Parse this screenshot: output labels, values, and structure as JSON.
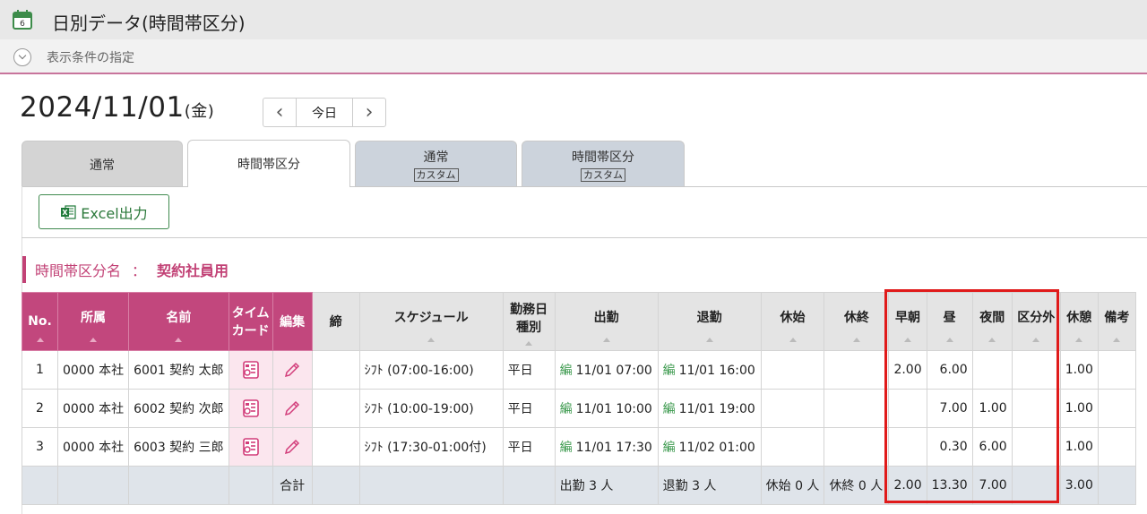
{
  "window": {
    "title": "日別データ(時間帯区分)"
  },
  "conditions": {
    "label": "表示条件の指定"
  },
  "date": {
    "value": "2024/11/01",
    "weekday": "(金)"
  },
  "nav": {
    "prev": "‹",
    "today": "今日",
    "next": "›"
  },
  "tabs": [
    {
      "label": "通常",
      "sub": ""
    },
    {
      "label": "時間帯区分",
      "sub": ""
    },
    {
      "label": "通常",
      "sub": "カスタム"
    },
    {
      "label": "時間帯区分",
      "sub": "カスタム"
    }
  ],
  "toolbar": {
    "excel_label": "Excel出力"
  },
  "section": {
    "label": "時間帯区分名",
    "separator": "：",
    "name": "契約社員用"
  },
  "table": {
    "headers": {
      "no": "No.",
      "dept": "所属",
      "name": "名前",
      "timecard_1": "タイム",
      "timecard_2": "カード",
      "edit": "編集",
      "close": "締",
      "schedule": "スケジュール",
      "daytype_1": "勤務日",
      "daytype_2": "種別",
      "in": "出勤",
      "out": "退勤",
      "break_start": "休始",
      "break_end": "休終",
      "early": "早朝",
      "day": "昼",
      "night": "夜間",
      "outside": "区分外",
      "rest": "休憩",
      "note": "備考"
    },
    "edit_marker": "編",
    "rows": [
      {
        "no": "1",
        "dept": "0000 本社",
        "name": "6001 契約 太郎",
        "schedule": "ｼﾌﾄ (07:00-16:00)",
        "daytype": "平日",
        "in": "11/01 07:00",
        "out": "11/01 16:00",
        "early": "2.00",
        "day": "6.00",
        "night": "",
        "outside": "",
        "rest": "1.00"
      },
      {
        "no": "2",
        "dept": "0000 本社",
        "name": "6002 契約 次郎",
        "schedule": "ｼﾌﾄ (10:00-19:00)",
        "daytype": "平日",
        "in": "11/01 10:00",
        "out": "11/01 19:00",
        "early": "",
        "day": "7.00",
        "night": "1.00",
        "outside": "",
        "rest": "1.00"
      },
      {
        "no": "3",
        "dept": "0000 本社",
        "name": "6003 契約 三郎",
        "schedule": "ｼﾌﾄ (17:30-01:00付)",
        "daytype": "平日",
        "in": "11/01 17:30",
        "out": "11/02 01:00",
        "early": "",
        "day": "0.30",
        "night": "6.00",
        "outside": "",
        "rest": "1.00"
      }
    ],
    "total": {
      "label": "合計",
      "in": "出勤 3 人",
      "out": "退勤 3 人",
      "break_start": "休始 0 人",
      "break_end": "休終 0 人",
      "early": "2.00",
      "day": "13.30",
      "night": "7.00",
      "outside": "",
      "rest": "3.00"
    }
  },
  "colors": {
    "accent": "#c2477d",
    "highlight_box": "#e01a1a",
    "excel_green": "#2d7a3c"
  }
}
